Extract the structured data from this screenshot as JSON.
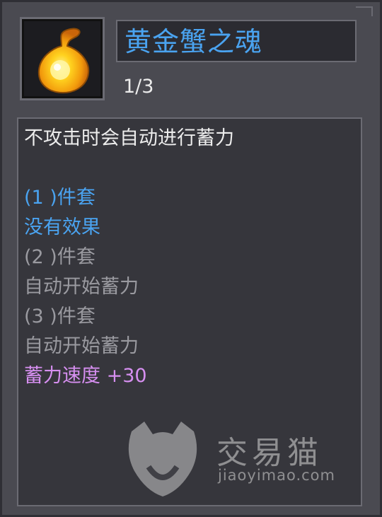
{
  "item": {
    "name": "黄金蟹之魂",
    "count": "1/3",
    "icon": "golden-soul-flame-icon"
  },
  "description": {
    "summary": "不攻击时会自动进行蓄力",
    "sets": [
      {
        "header": "(1 )件套",
        "effects": [
          "没有效果"
        ]
      },
      {
        "header": "(2 )件套",
        "effects": [
          "自动开始蓄力"
        ]
      },
      {
        "header": "(3 )件套",
        "effects": [
          "自动开始蓄力",
          "蓄力速度 +30"
        ]
      }
    ]
  },
  "watermark": {
    "brand": "交易猫",
    "url": "jiaoyimao.com"
  },
  "colors": {
    "active_set": "#4aa3f0",
    "inactive_set": "#9a9aa0",
    "bonus": "#d68ff0",
    "panel": "#4a4a51"
  }
}
